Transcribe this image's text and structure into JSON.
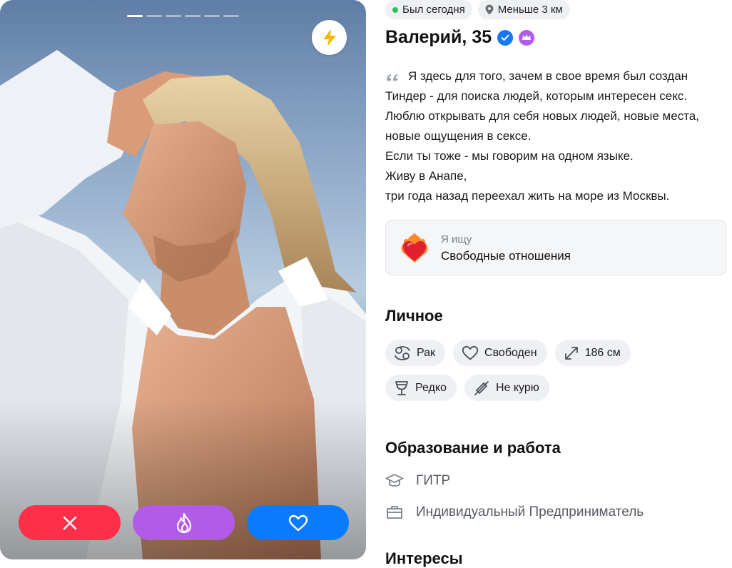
{
  "photo": {
    "total_photos": 6,
    "active_photo": 1
  },
  "actions": {
    "dislike": "close-icon",
    "superlike": "flame-icon",
    "like": "heart-icon"
  },
  "status": {
    "online": "Был сегодня",
    "distance": "Меньше 3 км"
  },
  "profile": {
    "name_age": "Валерий, 35",
    "verified": true,
    "premium": true
  },
  "bio": {
    "lines": [
      "Я здесь для того, зачем в свое время был создан",
      "Тиндер - для поиска людей, которым интересен секс.",
      "Люблю открывать для себя новых людей, новые места,",
      "новые ощущения в сексе.",
      "Если ты тоже - мы говорим на одном языке.",
      "Живу в Анапе,",
      "три года назад переехал жить на море из Москвы."
    ]
  },
  "looking_for": {
    "label": "Я ищу",
    "value": "Свободные отношения"
  },
  "personal": {
    "title": "Личное",
    "tags": [
      {
        "label": "Рак",
        "icon": "cancer-zodiac-icon"
      },
      {
        "label": "Свободен",
        "icon": "heart-outline-icon"
      },
      {
        "label": "186 см",
        "icon": "height-expand-icon"
      },
      {
        "label": "Редко",
        "icon": "wine-glass-icon"
      },
      {
        "label": "Не курю",
        "icon": "no-smoking-icon"
      }
    ]
  },
  "education_work": {
    "title": "Образование и работа",
    "education": "ГИТР",
    "work": "Индивидуальный Предприниматель"
  },
  "interests": {
    "title": "Интересы"
  },
  "colors": {
    "dislike": "#ff2f4a",
    "superlike": "#b25be8",
    "like": "#0a7bff",
    "boost": "#f5b800",
    "online": "#2fc25b"
  }
}
